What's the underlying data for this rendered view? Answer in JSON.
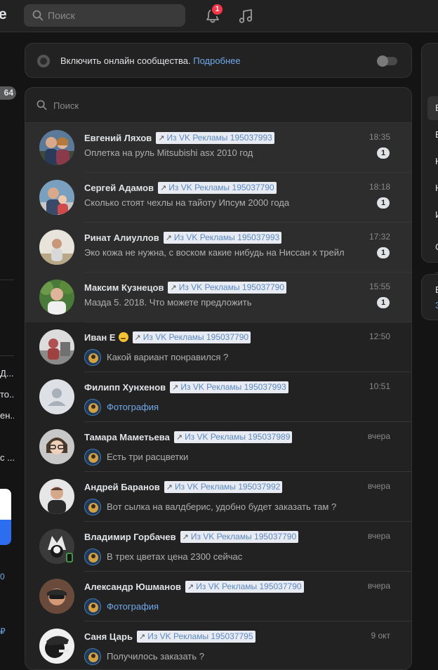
{
  "topbar": {
    "logo_tail": "e",
    "search_placeholder": "Поиск",
    "notification_count": "1"
  },
  "left_sidebar": {
    "count_badge": "64",
    "fragments": [
      "Д...",
      "то...",
      "ен...",
      "с ...",
      "0",
      "₽"
    ]
  },
  "online_community": {
    "text": "Включить онлайн сообщества.",
    "link": "Подробнее"
  },
  "messages": {
    "search_placeholder": "Поиск",
    "tag_prefix": "Из VK Рекламы",
    "rows": [
      {
        "name": "Евгений Ляхов",
        "tag_id": "195037993",
        "time": "18:35",
        "preview": "Оплетка на руль Mitsubishi asx 2010 год",
        "unread": "1"
      },
      {
        "name": "Сергей Адамов",
        "tag_id": "195037790",
        "time": "18:18",
        "preview": "Сколько стоят чехлы на тайоту Ипсум 2000 года",
        "unread": "1"
      },
      {
        "name": "Ринат Алиуллов",
        "tag_id": "195037993",
        "time": "17:32",
        "preview": "Эко кожа не нужна, с воском какие нибудь на Ниссан х трейл",
        "unread": "1"
      },
      {
        "name": "Максим Кузнецов",
        "tag_id": "195037790",
        "time": "15:55",
        "preview": "Мазда 5. 2018. Что можете предложить",
        "unread": "1"
      },
      {
        "name": "Иван Е",
        "tag_id": "195037790",
        "time": "12:50",
        "preview": "Какой вариант понравился ?"
      },
      {
        "name": "Филипп Хунхенов",
        "tag_id": "195037993",
        "time": "10:51",
        "preview": "Фотография"
      },
      {
        "name": "Тамара Маметьева",
        "tag_id": "195037989",
        "time": "вчера",
        "preview": "Есть три расцветки"
      },
      {
        "name": "Андрей Баранов",
        "tag_id": "195037992",
        "time": "вчера",
        "preview": "Вот сылка на валдберис, удобно будет заказать там ?"
      },
      {
        "name": "Владимир Горбачев",
        "tag_id": "195037790",
        "time": "вчера",
        "preview": "В трех цветах цена 2300 сейчас"
      },
      {
        "name": "Александр Юшманов",
        "tag_id": "195037790",
        "time": "вчера",
        "preview": "Фотография"
      },
      {
        "name": "Саня Царь",
        "tag_id": "195037795",
        "time": "9 окт",
        "preview": "Получилось заказать ?"
      }
    ]
  },
  "right_sidebar": {
    "fragments": [
      "В",
      "В",
      "Н",
      "Н",
      "И",
      "С"
    ],
    "card_fragments": [
      "В",
      "З"
    ]
  },
  "colors": {
    "background": "#141414",
    "panel": "#222222",
    "accent_link": "#71aaeb",
    "badge_red": "#ff3347"
  }
}
